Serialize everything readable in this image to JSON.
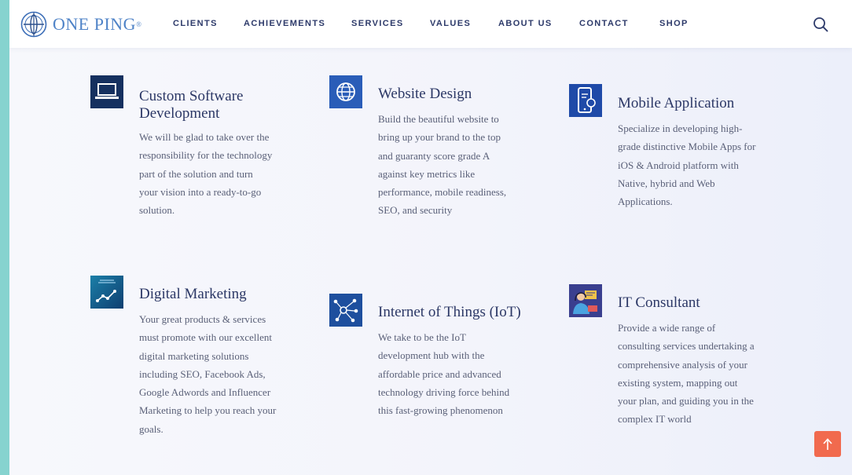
{
  "brand": {
    "name": "ONE PING",
    "reg": "®"
  },
  "nav": {
    "items": [
      {
        "label": "CLIENTS"
      },
      {
        "label": "ACHIEVEMENTS"
      },
      {
        "label": "SERVICES"
      },
      {
        "label": "VALUES"
      },
      {
        "label": "ABOUT US"
      },
      {
        "label": "CONTACT"
      },
      {
        "label": "SHOP"
      }
    ]
  },
  "services": [
    {
      "title_line1": "Custom Software",
      "title_line2": "Development",
      "desc": [
        "We will be glad to take over the",
        "responsibility for the technology",
        "part of the solution and turn",
        "your vision into a ready-to-go",
        "solution."
      ],
      "icon": "laptop-icon"
    },
    {
      "title_line1": "Website Design",
      "desc": [
        "Build the beautiful website to",
        "bring up your brand to the top",
        "and guaranty score grade A",
        "against key metrics like",
        "performance, mobile readiness,",
        "SEO, and security"
      ],
      "icon": "globe-icon"
    },
    {
      "title_line1": "Mobile Application",
      "desc": [
        "Specialize in developing high-",
        "grade distinctive Mobile Apps for",
        "iOS & Android platform with",
        "Native, hybrid and Web",
        "Applications."
      ],
      "icon": "mobile-phone-icon"
    },
    {
      "title_line1": "Digital Marketing",
      "desc": [
        "Your great products & services",
        "must promote with our excellent",
        "digital marketing solutions",
        "including SEO, Facebook Ads,",
        "Google Adwords and Influencer",
        "Marketing to help you reach your",
        "goals."
      ],
      "icon": "analytics-chart-icon"
    },
    {
      "title_line1": "Internet of Things (IoT)",
      "desc": [
        "We take to be the IoT",
        "development hub with the",
        "affordable price and advanced",
        "technology driving force behind",
        "this fast-growing phenomenon"
      ],
      "icon": "network-nodes-icon"
    },
    {
      "title_line1": "IT Consultant",
      "desc": [
        "Provide a wide range of",
        "consulting services undertaking a",
        "comprehensive analysis of your",
        "existing system, mapping out",
        "your plan, and guiding you in the",
        "complex IT world"
      ],
      "icon": "consultant-icon"
    }
  ],
  "colors": {
    "accent": "#2c3866",
    "icon_bg": "#2a5db8",
    "back_to_top": "#f16a4e",
    "frame_border": "#86d3cf"
  }
}
